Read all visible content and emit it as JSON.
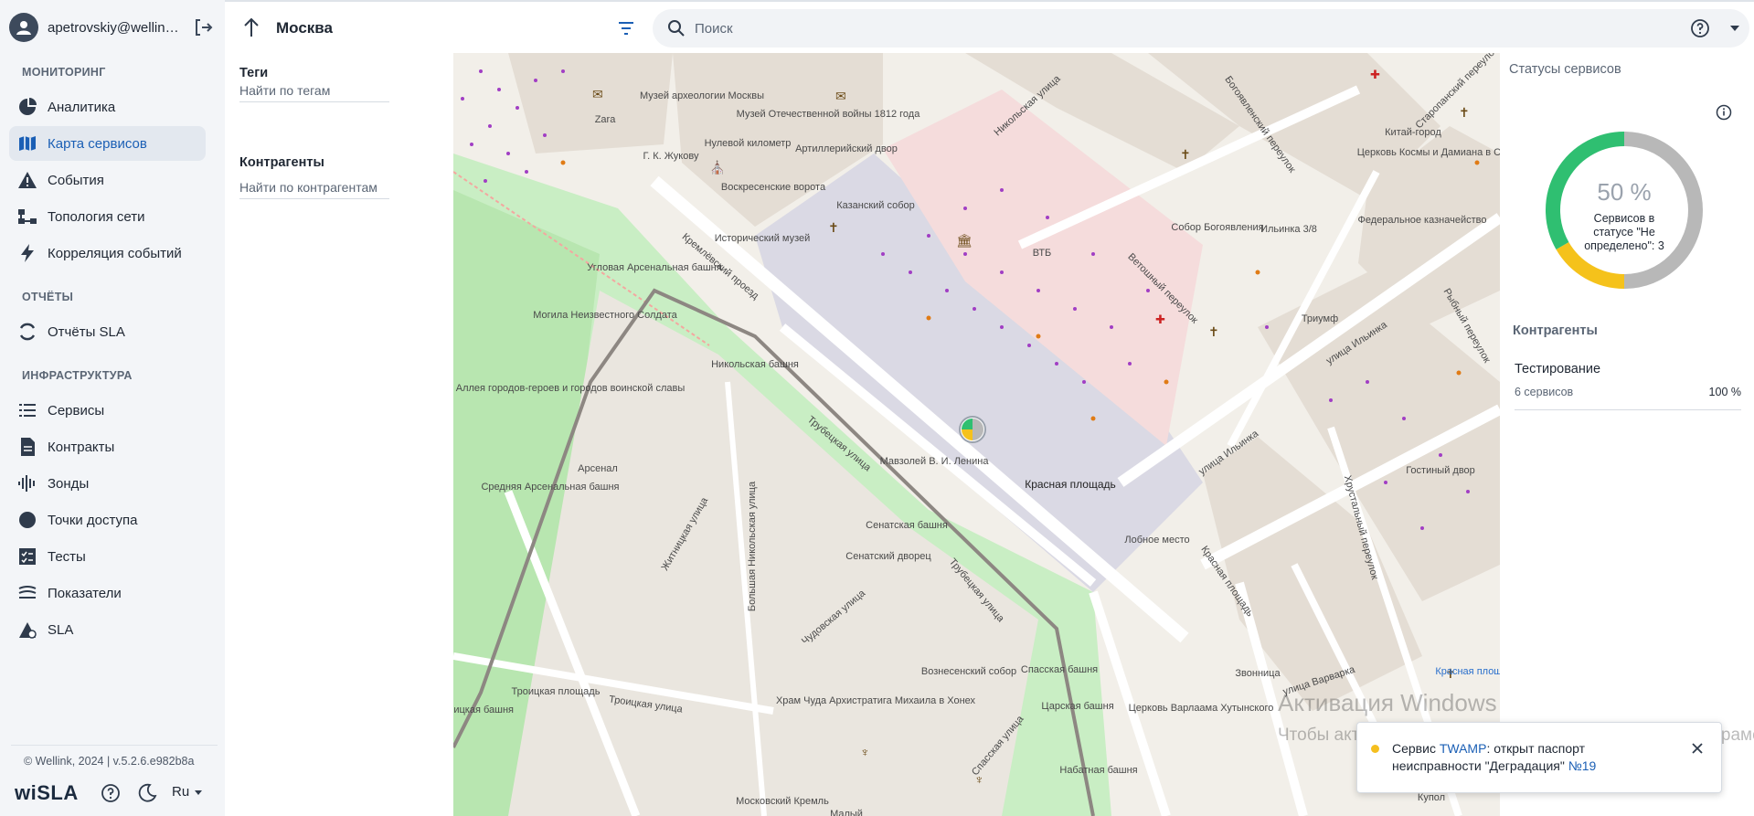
{
  "sidebar": {
    "user": "apetrovskiy@wellin…",
    "sections": {
      "monitoring": "МОНИТОРИНГ",
      "reports": "ОТЧЁТЫ",
      "infra": "ИНФРАСТРУКТУРА"
    },
    "items": {
      "analytics": "Аналитика",
      "service_map": "Карта сервисов",
      "events": "События",
      "topology": "Топология сети",
      "correlation": "Корреляция событий",
      "sla_reports": "Отчёты SLA",
      "services": "Сервисы",
      "contracts": "Контракты",
      "probes": "Зонды",
      "access_points": "Точки доступа",
      "tests": "Тесты",
      "metrics": "Показатели",
      "sla": "SLA"
    },
    "active_item": "Карта сервисов",
    "copyright": "© Wellink, 2024 | v.5.2.6.e982b8a",
    "logo": "wiSLA",
    "language": "Ru"
  },
  "header": {
    "city": "Москва",
    "search_placeholder": "Поиск"
  },
  "filters": {
    "tags_label": "Теги",
    "tags_placeholder": "Найти по тегам",
    "contractors_label": "Контрагенты",
    "contractors_placeholder": "Найти по контрагентам"
  },
  "map": {
    "labels": {
      "red_square": "Красная площадь",
      "kazan_cathedral": "Казанский собор",
      "resurrection_gates": "Воскресенские ворота",
      "historical_museum": "Исторический музей",
      "mausoleum": "Мавзолей В. И. Ленина",
      "senate_tower": "Сенатская башня",
      "senate_palace": "Сенатский дворец",
      "nikolskaya_tower": "Никольская башня",
      "spasskaya_tower": "Спасская башня",
      "tsarskaya_tower": "Царская башня",
      "nabatnaya_tower": "Набатная башня",
      "arsenal": "Арсенал",
      "middle_arsenal_tower": "Средняя Арсенальная башня",
      "corner_arsenal_tower": "Угловая Арсенальная башня",
      "troitskaya_square": "Троицкая площадь",
      "troitskaya_street": "Троицкая улица",
      "troitskaya_tower": "Троицкая башня",
      "kremlin_passage": "Кремлёвский проезд",
      "trubetskaya_1": "Трубецкая улица",
      "trubetskaya_2": "Трубецкая улица",
      "zhitnitskaya": "Житницкая улица",
      "bolshaya_nikolskaya": "Большая Никольская улица",
      "chudovskaya": "Чудовская улица",
      "spasskaya_street": "Спасская улица",
      "nikolskaya_street": "Никольская улица",
      "vetoshny": "Ветошный переулок",
      "ilyinka_1": "улица Ильинка",
      "ilyinka_2": "улица Ильинка",
      "khrustalny": "Хрустальный переулок",
      "krasnaya_passage": "Красная площадь",
      "varvarka": "улица Варварка",
      "gostiny_dvor": "Гостиный двор",
      "lobnoe_mesto": "Лобное место",
      "tsum_epiphany": "Собор Богоявления",
      "triumph": "Триумф",
      "vtb": "ВТБ",
      "voznesensky": "Вознесенский собор",
      "chudov": "Храм Чуда Архистратига Михаила в Хонех",
      "kremlin": "Московский Кремль",
      "war_museum": "Музей Отечественной войны 1812 года",
      "arch_museum": "Музей археологии Москвы",
      "zero_km": "Нулевой километр",
      "artillery": "Артиллерийский двор",
      "zhukov": "Г. К. Жукову",
      "unknown_soldier": "Могила Неизвестного Солдата",
      "hero_alley": "Аллея городов-героев и городов воинской славы",
      "varlaam": "Церковь Варлаама Хутынского",
      "bell": "Звонница",
      "kosma": "Церковь Космы и Дамиана в Старых Панех",
      "treasury": "Федеральное казначейство",
      "kitay_gorod": "Китай-город",
      "zara": "Zara",
      "ilyinka_38": "Ильинка 3/8",
      "rybny": "Рыбный переулок",
      "bogoyavlensky": "Богоявленский переулок",
      "starопanский": "Старопанский переулок",
      "krasnaya_sq_bus": "Красная площадь",
      "kupol": "Купол",
      "maly": "Малый"
    },
    "marker_colors": [
      "#1fbf6f",
      "#f5bf1f",
      "#b3b3b3"
    ]
  },
  "statuses": {
    "title": "Статусы сервисов",
    "percent": "50 %",
    "description": "Сервисов в статусе \"Не определено\": 3",
    "colors": {
      "ok": "#2fbf71",
      "warning": "#f5c21b",
      "unknown": "#b8b8b8"
    },
    "shares": {
      "ok": 0.3333,
      "warning": 0.1667,
      "unknown": 0.5
    }
  },
  "contractors": {
    "title": "Контрагенты",
    "items": [
      {
        "name": "Тестирование",
        "services": "6 сервисов",
        "percent": "100 %"
      }
    ]
  },
  "watermark": {
    "line1": "Активация Windows",
    "line2": "Чтобы активировать Windows, перейдите в раздел \"Параметры\"."
  },
  "notification": {
    "prefix": "Сервис ",
    "service": "TWAMP",
    "middle": ": открыт паспорт неисправности \"Деградация\" ",
    "ticket": "№19"
  }
}
